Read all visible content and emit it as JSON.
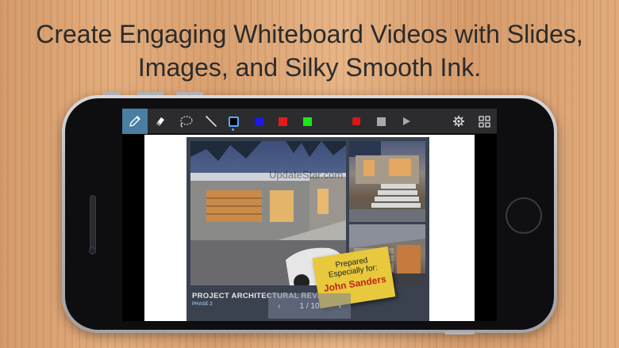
{
  "headline": {
    "line1": "Create Engaging Whiteboard Videos with Slides,",
    "line2": "Images, and Silky Smooth Ink."
  },
  "toolbar": {
    "tools": [
      {
        "name": "pen-icon",
        "active": true
      },
      {
        "name": "eraser-icon",
        "active": false
      },
      {
        "name": "lasso-icon",
        "active": false
      },
      {
        "name": "laser-pointer-icon",
        "active": false
      }
    ],
    "colors": {
      "black": "#000000",
      "blue": "#1a1ae6",
      "red": "#e61a1a",
      "green": "#1ae61a"
    },
    "selected_color": "black",
    "record_color": "#d81818",
    "stop_color": "#a8a8a8",
    "accent": "#4a7ea3"
  },
  "slide": {
    "watermark": "UpdateStar.com",
    "title": "PROJECT ARCHITECTURAL REVIEW",
    "subtitle": "PHASE 2",
    "sticky_line1": "Prepared",
    "sticky_line2": "Especially for:",
    "sticky_name": "John Sanders"
  },
  "pager": {
    "text": "1 / 10",
    "prev": "‹",
    "next": "›"
  }
}
